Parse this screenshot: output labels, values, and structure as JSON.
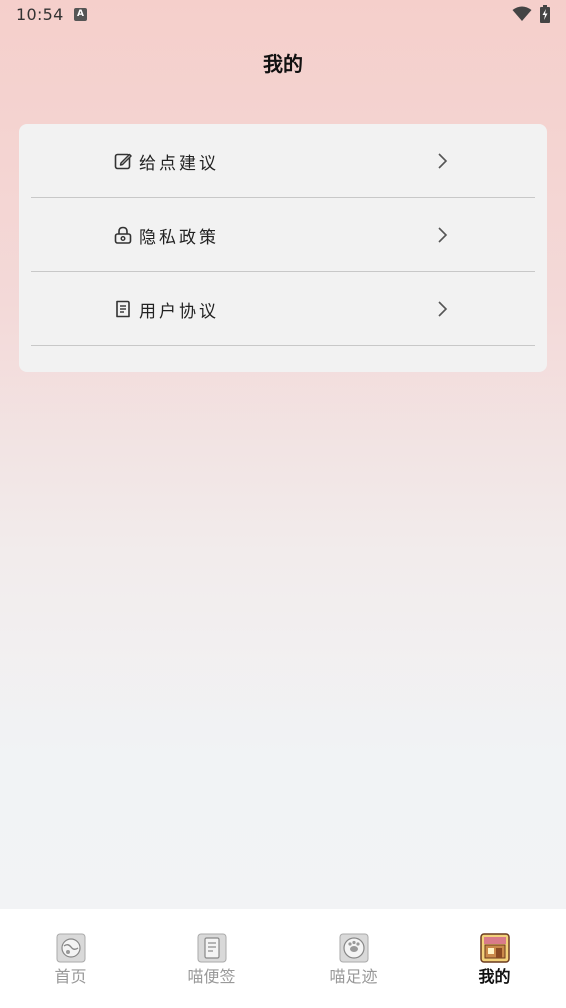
{
  "status_bar": {
    "time": "10:54",
    "notification_icon": "a-icon",
    "wifi_icon": "wifi-icon",
    "battery_icon": "battery-charging-icon"
  },
  "header": {
    "title": "我的"
  },
  "menu": {
    "items": [
      {
        "icon": "edit-icon",
        "label": "给点建议"
      },
      {
        "icon": "lock-icon",
        "label": "隐私政策"
      },
      {
        "icon": "document-icon",
        "label": "用户协议"
      }
    ]
  },
  "tab_bar": {
    "active_index": 3,
    "tabs": [
      {
        "icon": "home-icon",
        "label": "首页"
      },
      {
        "icon": "notes-icon",
        "label": "喵便签"
      },
      {
        "icon": "footprint-icon",
        "label": "喵足迹"
      },
      {
        "icon": "profile-icon",
        "label": "我的"
      }
    ]
  },
  "colors": {
    "gradient_top": "#f5cfcb",
    "gradient_bottom": "#f2f3f5",
    "card_background": "#f2f2f2",
    "divider": "#c8c8c8",
    "tab_inactive": "#999999",
    "tab_active": "#111111"
  }
}
